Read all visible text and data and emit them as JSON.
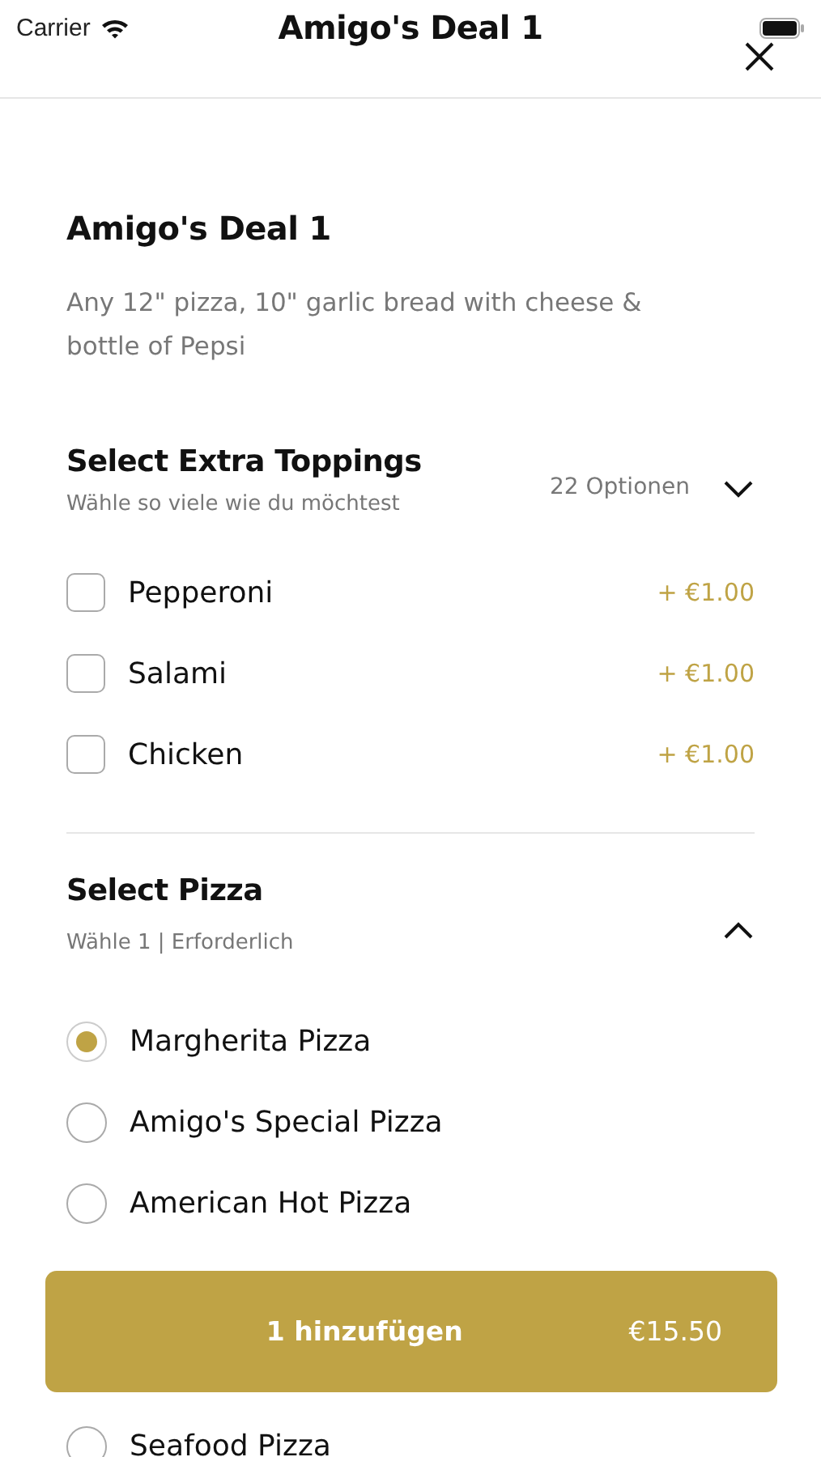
{
  "status_bar": {
    "carrier": "Carrier"
  },
  "header": {
    "title": "Amigo's Deal 1"
  },
  "product": {
    "title": "Amigo's Deal 1",
    "description": "Any 12\" pizza, 10\" garlic bread with cheese & bottle of Pepsi"
  },
  "sections": [
    {
      "kind": "checkbox",
      "title": "Select Extra Toppings",
      "subtitle": "Wähle so viele wie du möchtest",
      "option_count": "22 Optionen",
      "expanded": false,
      "items": [
        {
          "label": "Pepperoni",
          "price": "+ €1.00",
          "checked": false
        },
        {
          "label": "Salami",
          "price": "+ €1.00",
          "checked": false
        },
        {
          "label": "Chicken",
          "price": "+ €1.00",
          "checked": false
        }
      ]
    },
    {
      "kind": "radio",
      "title": "Select Pizza",
      "subtitle": "Wähle 1 | Erforderlich",
      "expanded": true,
      "items": [
        {
          "label": "Margherita Pizza",
          "selected": true
        },
        {
          "label": "Amigo's Special Pizza",
          "selected": false
        },
        {
          "label": "American Hot Pizza",
          "selected": false
        },
        {
          "label": "Seafood Pizza",
          "selected": false
        }
      ]
    }
  ],
  "add_button": {
    "label": "1 hinzufügen",
    "price": "€15.50"
  }
}
